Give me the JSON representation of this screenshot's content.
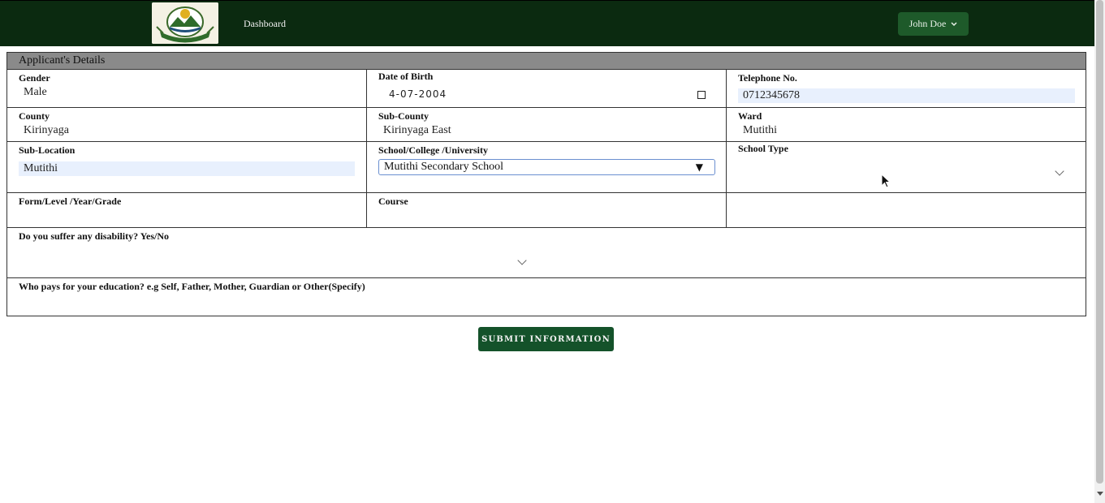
{
  "header": {
    "logo_icon": "county-crest-logo",
    "nav_dashboard": "Dashboard",
    "user_name": "John Doe",
    "background": "#0b2a10",
    "user_button_color": "#1e5a2a"
  },
  "form": {
    "section_title": "Applicant's Details",
    "gender": {
      "label": "Gender",
      "value": "Male"
    },
    "dob": {
      "label": "Date of Birth",
      "value": "4-07-2004"
    },
    "telephone": {
      "label": "Telephone No.",
      "value": "0712345678"
    },
    "county": {
      "label": "County",
      "value": "Kirinyaga"
    },
    "subcounty": {
      "label": "Sub-County",
      "value": "Kirinyaga East"
    },
    "ward": {
      "label": "Ward",
      "value": "Mutithi"
    },
    "sublocation": {
      "label": "Sub-Location",
      "value": "Mutithi"
    },
    "school": {
      "label": "School/College /University",
      "value": "Mutithi Secondary School"
    },
    "school_type": {
      "label": "School Type",
      "value": ""
    },
    "form_level": {
      "label": "Form/Level /Year/Grade",
      "value": ""
    },
    "course": {
      "label": "Course",
      "value": ""
    },
    "disability": {
      "label": "Do you suffer any disability? Yes/No",
      "value": ""
    },
    "payer": {
      "label": "Who pays for your education? e.g Self, Father, Mother, Guardian or Other(Specify)",
      "value": ""
    }
  },
  "actions": {
    "submit_label": "SUBMIT INFORMATION",
    "submit_color": "#14522a"
  }
}
